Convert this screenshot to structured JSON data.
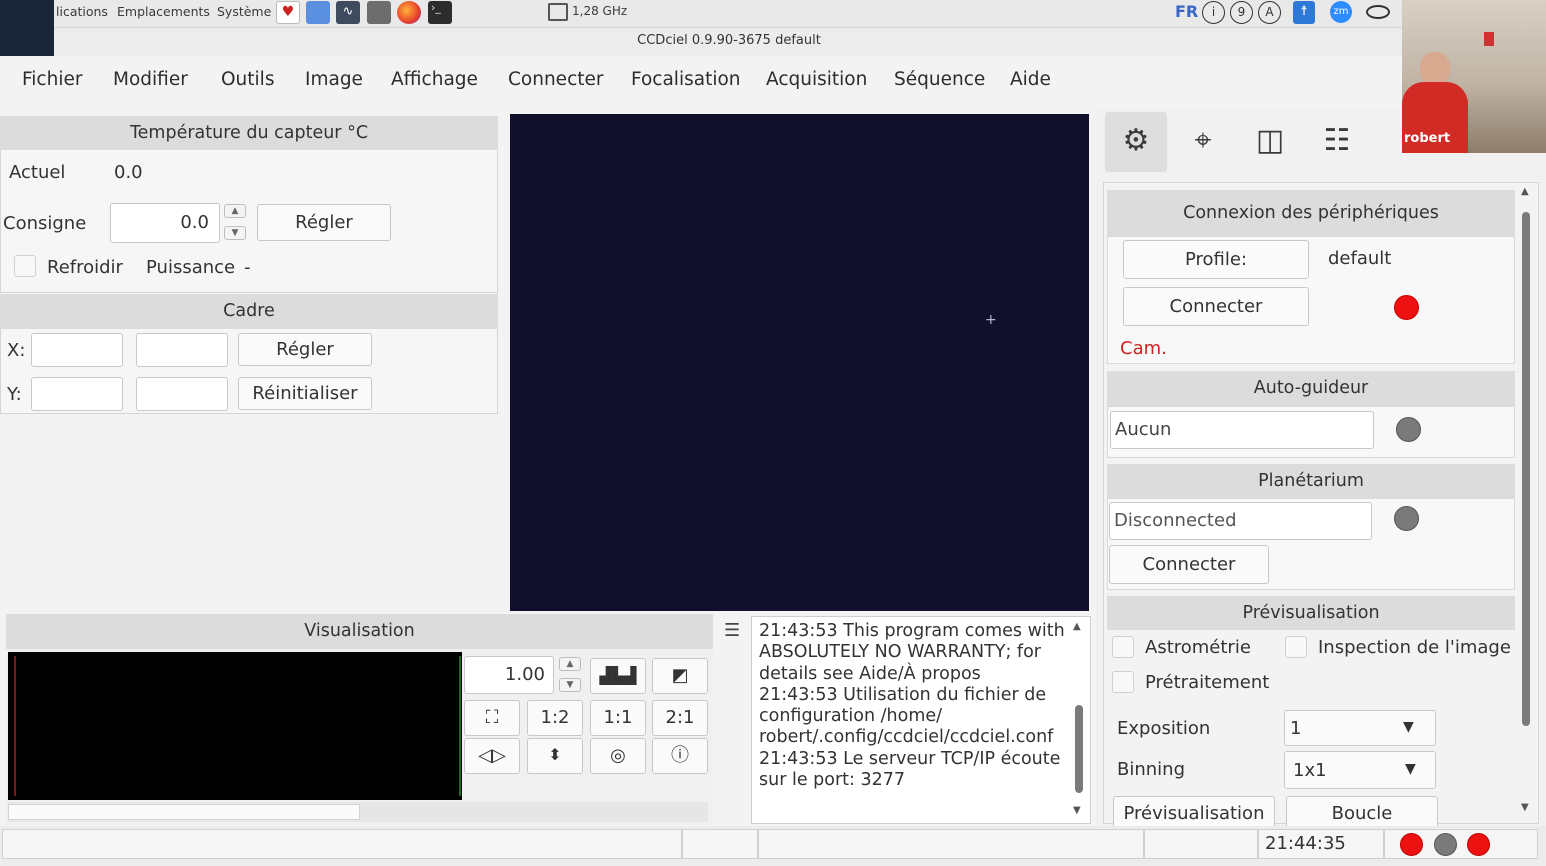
{
  "system_panel": {
    "applications_partial": "lications",
    "places": "Emplacements",
    "system": "Système",
    "cpu_freq": "1,28 GHz",
    "lang": "FR",
    "tray_circle_1": "i",
    "tray_circle_2": "9",
    "tray_circle_3": "A",
    "zoom_label": "zm"
  },
  "window": {
    "title": "CCDciel 0.9.90-3675 default"
  },
  "menu": {
    "items": [
      "Fichier",
      "Modifier",
      "Outils",
      "Image",
      "Affichage",
      "Connecter",
      "Focalisation",
      "Acquisition",
      "Séquence",
      "Aide"
    ]
  },
  "temperature": {
    "header": "Température du capteur °C",
    "current_label": "Actuel",
    "current_value": "0.0",
    "setpoint_label": "Consigne",
    "setpoint_value": "0.0",
    "set_button": "Régler",
    "cool_label": "Refroidir",
    "power_label": "Puissance",
    "power_value": "-"
  },
  "frame": {
    "header": "Cadre",
    "x_label": "X:",
    "y_label": "Y:",
    "set_button": "Régler",
    "reset_button": "Réinitialiser"
  },
  "visualisation": {
    "header": "Visualisation",
    "zoom_value": "1.00",
    "zoom_half": "1:2",
    "zoom_one": "1:1",
    "zoom_two": "2:1"
  },
  "log": {
    "menu_glyph": "☰",
    "lines": [
      "21:43:53 This program comes with",
      "ABSOLUTELY NO WARRANTY; for",
      "details see Aide/À propos",
      "21:43:53 Utilisation du fichier de",
      "configuration /home/",
      "robert/.config/ccdciel/ccdciel.conf",
      "21:43:53 Le serveur TCP/IP écoute",
      "sur le port: 3277"
    ]
  },
  "right_panel": {
    "connection_header": "Connexion des périphériques",
    "profile_button": "Profile:",
    "profile_value": "default",
    "connect_button": "Connecter",
    "cam_label": "Cam.",
    "autoguider_header": "Auto-guideur",
    "autoguider_value": "Aucun",
    "planetarium_header": "Planétarium",
    "planetarium_value": "Disconnected",
    "planetarium_connect": "Connecter",
    "preview_header": "Prévisualisation",
    "astrometry_label": "Astrométrie",
    "inspection_label": "Inspection de l'image",
    "preprocessing_label": "Prétraitement",
    "exposure_label": "Exposition",
    "exposure_value": "1",
    "binning_label": "Binning",
    "binning_value": "1x1",
    "preview_button": "Prévisualisation",
    "loop_button": "Boucle"
  },
  "webcam": {
    "name": "robert"
  },
  "statusbar": {
    "time": "21:44:35"
  },
  "colors": {
    "image_bg": "#10102c",
    "status_red": "#ee1111",
    "status_gray": "#7a7a7a",
    "cam_red": "#d42020"
  }
}
